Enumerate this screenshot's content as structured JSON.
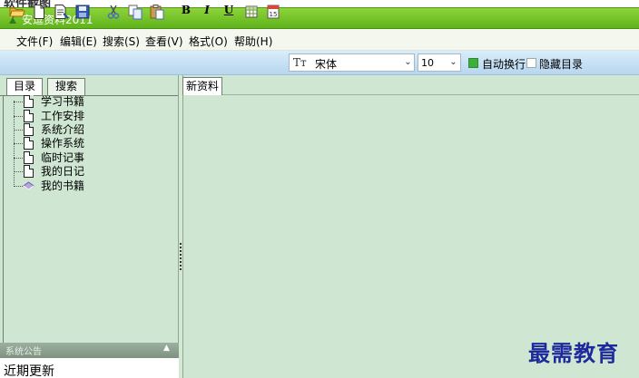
{
  "top_strip": {
    "cropped_text": "软件截图"
  },
  "window": {
    "title": "安逗资料2011"
  },
  "menu": [
    {
      "label": "文件(F)"
    },
    {
      "label": "编辑(E)"
    },
    {
      "label": "搜索(S)"
    },
    {
      "label": "查看(V)"
    },
    {
      "label": "格式(O)"
    },
    {
      "label": "帮助(H)"
    }
  ],
  "toolbar": {
    "bold_label": "B",
    "italic_label": "I",
    "underline_label": "U",
    "font_icon_text": "Tт",
    "font_name": "宋体",
    "font_size": "10",
    "word_wrap": {
      "label": "自动换行",
      "checked": true
    },
    "hide_toc": {
      "label": "隐藏目录",
      "checked": false
    }
  },
  "left_panel": {
    "tabs": [
      {
        "label": "目录",
        "active": true
      },
      {
        "label": "搜索",
        "active": false
      }
    ],
    "tree": [
      {
        "label": "学习书籍",
        "icon": "document-icon"
      },
      {
        "label": "工作安排",
        "icon": "document-icon"
      },
      {
        "label": "系统介绍",
        "icon": "document-icon"
      },
      {
        "label": "操作系统",
        "icon": "document-icon"
      },
      {
        "label": "临时记事",
        "icon": "document-icon"
      },
      {
        "label": "我的日记",
        "icon": "document-icon"
      },
      {
        "label": "我的书籍",
        "icon": "book-icon"
      }
    ],
    "notice": {
      "title": "系统公告",
      "content": "近期更新"
    }
  },
  "editor": {
    "tab_label": "新资料"
  },
  "watermark": "最需教育",
  "colors": {
    "titlebar": "#6cc02a",
    "panel_bg": "#cfe7d2",
    "toolbar_bg": "#c8e2f6",
    "watermark": "#1e2a9c"
  }
}
